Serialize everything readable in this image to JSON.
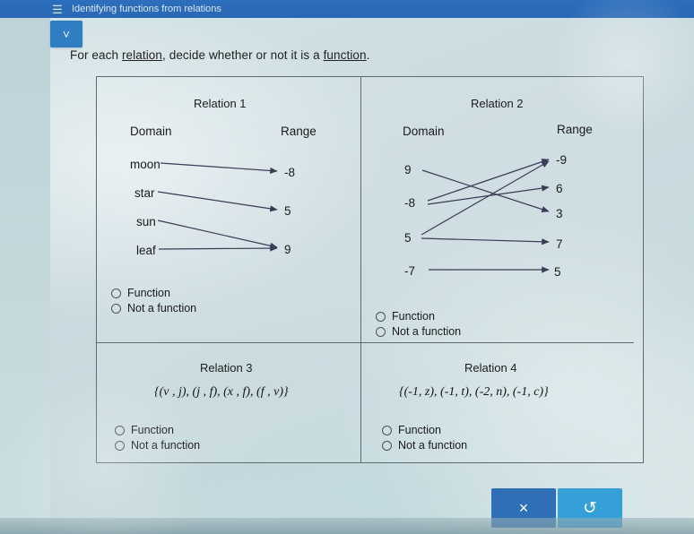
{
  "topbar": {
    "menu_icon": "hamburger-icon",
    "title": "Identifying functions from relations"
  },
  "chevron_button": {
    "icon": "chevron-down-icon"
  },
  "prompt": {
    "part1": "For each ",
    "link1": "relation",
    "part2": ", decide whether or not it is a ",
    "link2": "function",
    "part3": "."
  },
  "options": {
    "function": "Function",
    "not_function": "Not a function"
  },
  "relations": [
    {
      "title": "Relation 1",
      "domain_label": "Domain",
      "range_label": "Range",
      "domain": [
        "moon",
        "star",
        "sun",
        "leaf"
      ],
      "range": [
        "-8",
        "5",
        "9"
      ],
      "mappings": [
        {
          "from": "moon",
          "to": "-8"
        },
        {
          "from": "star",
          "to": "5"
        },
        {
          "from": "sun",
          "to": "9"
        },
        {
          "from": "leaf",
          "to": "9"
        }
      ]
    },
    {
      "title": "Relation 2",
      "domain_label": "Domain",
      "range_label": "Range",
      "domain": [
        "9",
        "-8",
        "5",
        "-7"
      ],
      "range": [
        "-9",
        "6",
        "3",
        "7",
        "5"
      ],
      "mappings": [
        {
          "from": "9",
          "to": "3"
        },
        {
          "from": "-8",
          "to": "-9"
        },
        {
          "from": "-8",
          "to": "6"
        },
        {
          "from": "5",
          "to": "-9"
        },
        {
          "from": "5",
          "to": "7"
        },
        {
          "from": "-7",
          "to": "5"
        }
      ]
    },
    {
      "title": "Relation 3",
      "expression": "{(v , j), (j , f), (x , f), (f , v)}"
    },
    {
      "title": "Relation 4",
      "expression": "{(-1, z), (-1, t), (-2, n), (-1, c)}"
    }
  ],
  "buttons": {
    "clear_label": "×",
    "refresh_label": "↺"
  }
}
